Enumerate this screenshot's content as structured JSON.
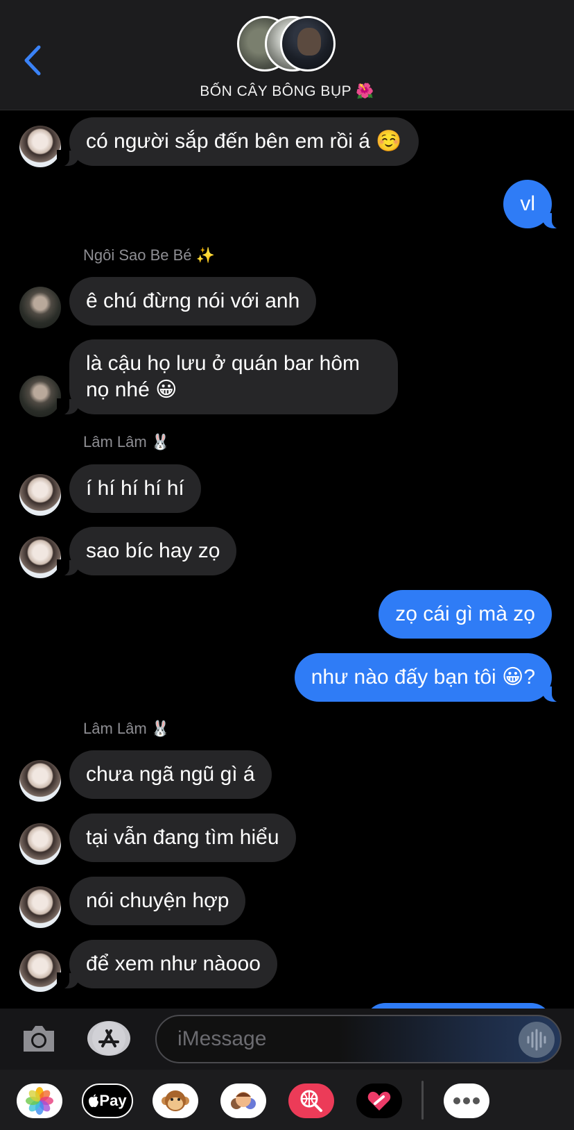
{
  "header": {
    "group_name": "BỐN CÂY BÔNG BỤP 🌺"
  },
  "senders": {
    "s1": "Ngôi Sao Be Bé ✨",
    "s2": "Lâm Lâm 🐰",
    "s3": "Lâm Lâm 🐰"
  },
  "messages": [
    {
      "text": "có người sắp đến bên em rồi á ☺️"
    },
    {
      "text": "vl"
    },
    {
      "text": "ê chú đừng nói với anh"
    },
    {
      "line1": "là cậu họ lưu ở quán bar hôm",
      "line2": "nọ nhé 😀"
    },
    {
      "text": "í hí hí hí hí"
    },
    {
      "text": "sao bíc hay zọ"
    },
    {
      "text": "zọ cái gì mà zọ"
    },
    {
      "text": "như nào đấy bạn tôi 😀?"
    },
    {
      "text": "chưa ngã ngũ gì á"
    },
    {
      "text": "tại vẫn đang tìm hiểu"
    },
    {
      "text": "nói chuyện hợp"
    },
    {
      "text": "để xem như nàooo"
    }
  ],
  "input": {
    "placeholder": "iMessage"
  },
  "drawer": {
    "apple_pay_label": "Pay"
  },
  "icons": {
    "back": "chevron-left-icon",
    "camera": "camera-icon",
    "appstore": "appstore-icon",
    "audio": "waveform-icon",
    "photos": "photos-icon",
    "applepay": "apple-pay-icon",
    "animoji": "monkey-animoji-icon",
    "memoji": "memoji-icon",
    "search": "globe-search-icon",
    "digitaltouch": "digital-touch-heart-icon",
    "more": "more-icon"
  },
  "colors": {
    "outgoing": "#2f7cf6",
    "incoming": "#262628",
    "accent": "#3a82f7"
  }
}
